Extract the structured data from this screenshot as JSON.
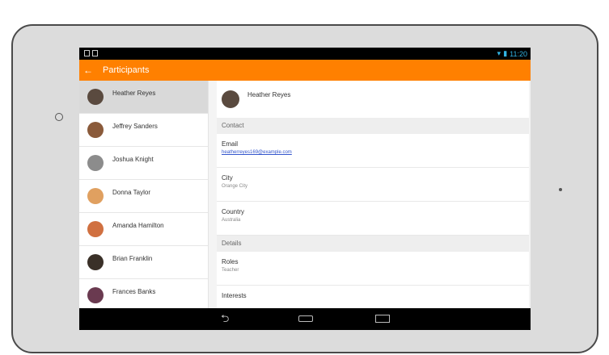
{
  "actionbar": {
    "title": "Participants",
    "back_icon": "arrow-back-icon"
  },
  "statusbar": {
    "time": "11:20"
  },
  "participants": [
    {
      "name": "Heather Reyes",
      "selected": true,
      "avatar_color": "#5a4a3f"
    },
    {
      "name": "Jeffrey Sanders",
      "selected": false,
      "avatar_color": "#8a5a3a"
    },
    {
      "name": "Joshua Knight",
      "selected": false,
      "avatar_color": "#8c8c8c"
    },
    {
      "name": "Donna Taylor",
      "selected": false,
      "avatar_color": "#e0a060"
    },
    {
      "name": "Amanda Hamilton",
      "selected": false,
      "avatar_color": "#d07040"
    },
    {
      "name": "Brian Franklin",
      "selected": false,
      "avatar_color": "#3a3028"
    },
    {
      "name": "Frances Banks",
      "selected": false,
      "avatar_color": "#6a3a50"
    }
  ],
  "detail": {
    "name": "Heather Reyes",
    "sections": {
      "contact": "Contact",
      "details": "Details"
    },
    "email_label": "Email",
    "email_value": "heatherreyes169@example.com",
    "city_label": "City",
    "city_value": "Orange City",
    "country_label": "Country",
    "country_value": "Australia",
    "roles_label": "Roles",
    "roles_value": "Teacher",
    "interests_label": "Interests"
  },
  "colors": {
    "accent": "#ff8000",
    "selected_row": "#d9d9d9",
    "link": "#3355cc"
  }
}
